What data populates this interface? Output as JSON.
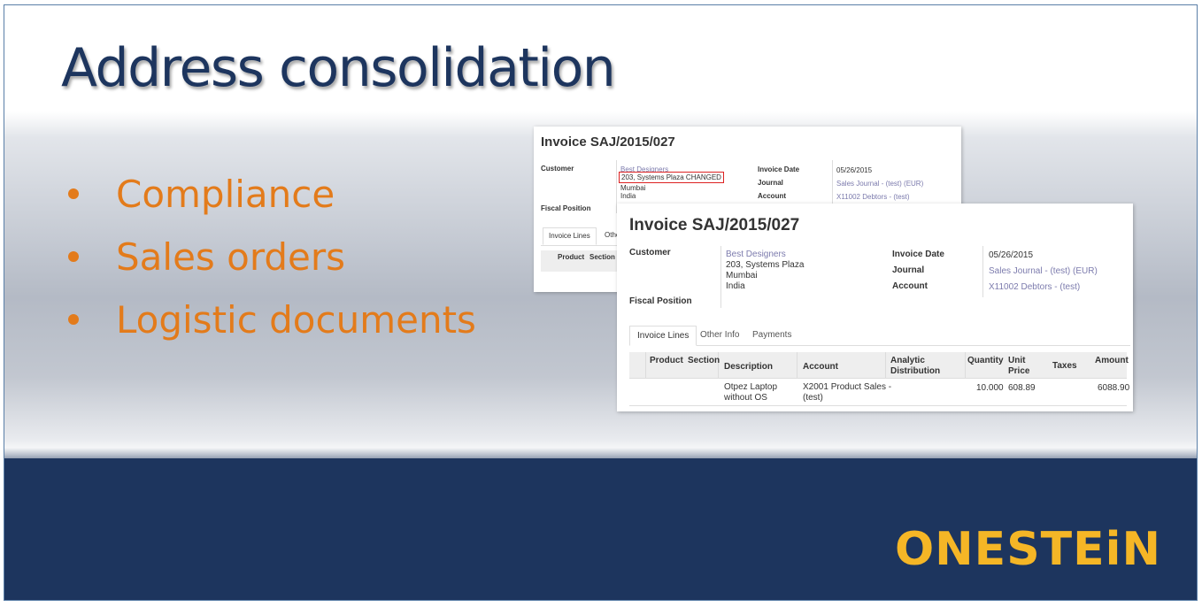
{
  "slide": {
    "title": "Address consolidation",
    "bullets": [
      "Compliance",
      "Sales orders",
      "Logistic documents"
    ],
    "logo_text": "ONESTEiN",
    "colors": {
      "title": "#1d355e",
      "bullet": "#e37b1b",
      "footer": "#1d355e",
      "logo": "#f5b626"
    }
  },
  "invoice_back": {
    "title": "Invoice SAJ/2015/027",
    "customer_label": "Customer",
    "customer_name": "Best Designers",
    "address_changed": "203, Systems Plaza CHANGED",
    "city": "Mumbai",
    "country": "India",
    "fiscal_label": "Fiscal Position",
    "invoice_date_label": "Invoice Date",
    "invoice_date": "05/26/2015",
    "journal_label": "Journal",
    "journal": "Sales Journal - (test) (EUR)",
    "account_label": "Account",
    "account": "X11002 Debtors - (test)",
    "tabs": [
      "Invoice Lines",
      "Other"
    ],
    "columns": [
      "Product",
      "Section"
    ]
  },
  "invoice_front": {
    "title": "Invoice SAJ/2015/027",
    "customer_label": "Customer",
    "customer_name": "Best Designers",
    "address": "203, Systems Plaza",
    "city": "Mumbai",
    "country": "India",
    "fiscal_label": "Fiscal Position",
    "invoice_date_label": "Invoice Date",
    "invoice_date": "05/26/2015",
    "journal_label": "Journal",
    "journal": "Sales Journal - (test) (EUR)",
    "account_label": "Account",
    "account": "X11002 Debtors - (test)",
    "tabs": [
      "Invoice Lines",
      "Other Info",
      "Payments"
    ],
    "columns": {
      "product": "Product",
      "section": "Section",
      "description": "Description",
      "account": "Account",
      "analytic": "Analytic\nDistribution",
      "quantity": "Quantity",
      "unit_price": "Unit\nPrice",
      "taxes": "Taxes",
      "amount": "Amount"
    },
    "lines": [
      {
        "description": "Otpez Laptop\nwithout OS",
        "account": "X2001 Product Sales -\n(test)",
        "quantity": "10.000",
        "unit_price": "608.89",
        "amount": "6088.90"
      }
    ]
  }
}
